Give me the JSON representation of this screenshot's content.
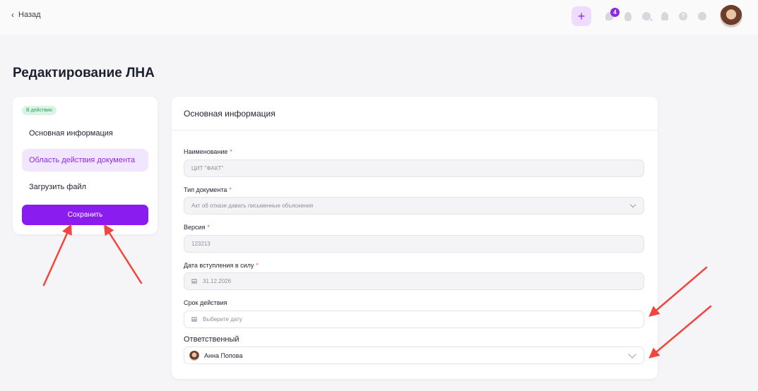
{
  "topbar": {
    "back_label": "Назад",
    "plus_label": "+",
    "chat_badge": "4",
    "help_label": "?"
  },
  "page": {
    "title": "Редактирование ЛНА"
  },
  "sidebar": {
    "status": "В действии",
    "items": [
      {
        "label": "Основная информация",
        "active": false
      },
      {
        "label": "Область действия документа",
        "active": true
      },
      {
        "label": "Загрузить файл",
        "active": false
      }
    ],
    "save_label": "Сохранить"
  },
  "form": {
    "section_title": "Основная информация",
    "fields": {
      "name": {
        "label": "Наименование",
        "value": "ЦИТ \"ФАКТ\""
      },
      "doc_type": {
        "label": "Тип документа",
        "value": "Акт об отказе давать письменные объяснения"
      },
      "version": {
        "label": "Версия",
        "value": "123213"
      },
      "effective_date": {
        "label": "Дата вступления в силу",
        "value": "31.12.2026"
      },
      "validity": {
        "label": "Срок действия",
        "placeholder": "Выберите дату"
      },
      "responsible": {
        "label": "Ответственный",
        "value": "Анна Попова"
      }
    },
    "required_mark": "*"
  },
  "colors": {
    "accent": "#8a1cf0",
    "accent_soft": "#f2e6ff",
    "status_bg": "#d8f4e4",
    "status_text": "#2a9d5c",
    "annotation_arrow": "#f2453d"
  },
  "icons": [
    "chevron-left-icon",
    "plus-icon",
    "chat-icon",
    "bulb-icon",
    "search-icon",
    "bell-icon",
    "help-icon",
    "settings-icon",
    "calendar-icon",
    "chevron-down-icon"
  ]
}
